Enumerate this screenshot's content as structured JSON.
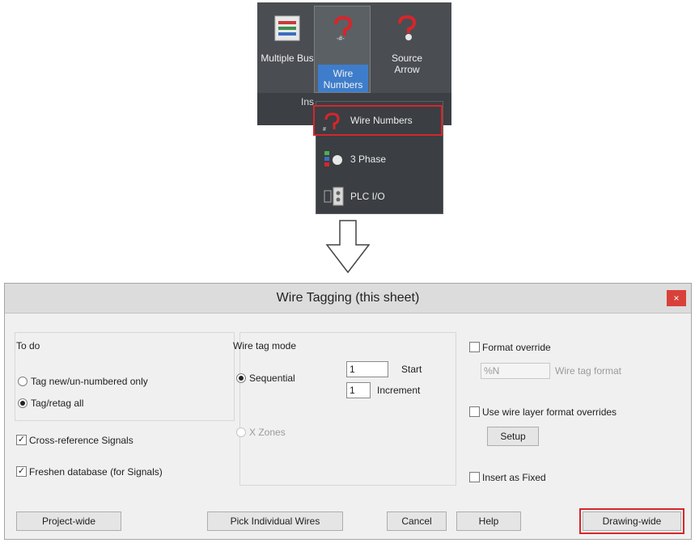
{
  "ribbon": {
    "multiple_bus_label": "Multiple Bus",
    "wire_numbers_label": "Wire Numbers",
    "source_arrow_label": "Source Arrow",
    "insert_panel_label": "Ins"
  },
  "dropdown": {
    "items": [
      {
        "label": "Wire  Numbers"
      },
      {
        "label": "3 Phase"
      },
      {
        "label": "PLC I/O"
      }
    ],
    "highlight_color": "#d6262b"
  },
  "dialog": {
    "title": "Wire Tagging (this sheet)",
    "close_label": "×",
    "todo": {
      "heading": "To do",
      "option_new": "Tag new/un-numbered only",
      "option_all": "Tag/retag all",
      "selected": "Tag/retag all"
    },
    "cross_reference": {
      "label": "Cross-reference Signals",
      "checked": true
    },
    "freshen": {
      "label": "Freshen database (for Signals)",
      "checked": true
    },
    "mode": {
      "heading": "Wire tag mode",
      "sequential": "Sequential",
      "xzones": "X Zones",
      "selected": "Sequential",
      "start_value": "1",
      "start_label": "Start",
      "increment_value": "1",
      "increment_label": "Increment"
    },
    "format_override": {
      "label": "Format override",
      "checked": false,
      "value": "%N",
      "format_label": "Wire tag format"
    },
    "wire_layer": {
      "label": "Use wire layer format overrides",
      "checked": false,
      "setup_label": "Setup"
    },
    "insert_fixed": {
      "label": "Insert as Fixed",
      "checked": false
    },
    "buttons": {
      "project_wide": "Project-wide",
      "pick_individual": "Pick Individual Wires",
      "cancel": "Cancel",
      "help": "Help",
      "drawing_wide": "Drawing-wide"
    }
  },
  "colors": {
    "ribbon_bg": "#4a4d52",
    "active_blue": "#3e7dcc",
    "highlight_red": "#d6262b",
    "dialog_bg": "#f0f0f0"
  }
}
